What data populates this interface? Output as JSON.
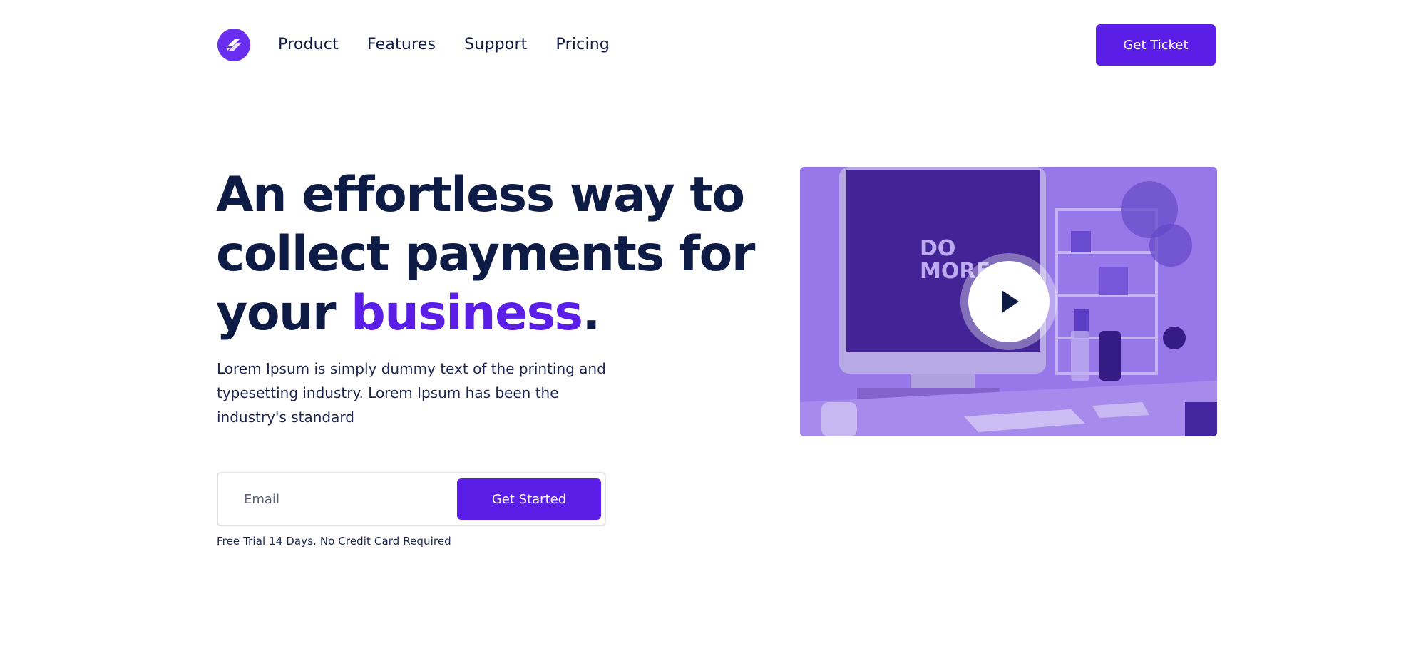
{
  "header": {
    "logo_icon": "double-arrow-logo-icon",
    "nav": [
      {
        "label": "Product"
      },
      {
        "label": "Features"
      },
      {
        "label": "Support"
      },
      {
        "label": "Pricing"
      }
    ],
    "cta_label": "Get Ticket"
  },
  "hero": {
    "title_line1": "An effortless way to",
    "title_line2": "collect payments for",
    "title_line3_start": "your ",
    "title_accent": "business",
    "title_end": ".",
    "description": "Lorem Ipsum is simply dummy text of the printing and typesetting industry. Lorem Ipsum has been the industry's standard",
    "email_placeholder": "Email",
    "email_value": "",
    "submit_label": "Get Started",
    "note": "Free Trial 14 Days. No Credit Card Required"
  },
  "video": {
    "screen_text_line1": "DO",
    "screen_text_line2": "MORE",
    "play_icon": "play-icon"
  },
  "colors": {
    "accent": "#5b1ee6",
    "heading": "#0d1b45",
    "video_overlay": "#7b52e6"
  }
}
